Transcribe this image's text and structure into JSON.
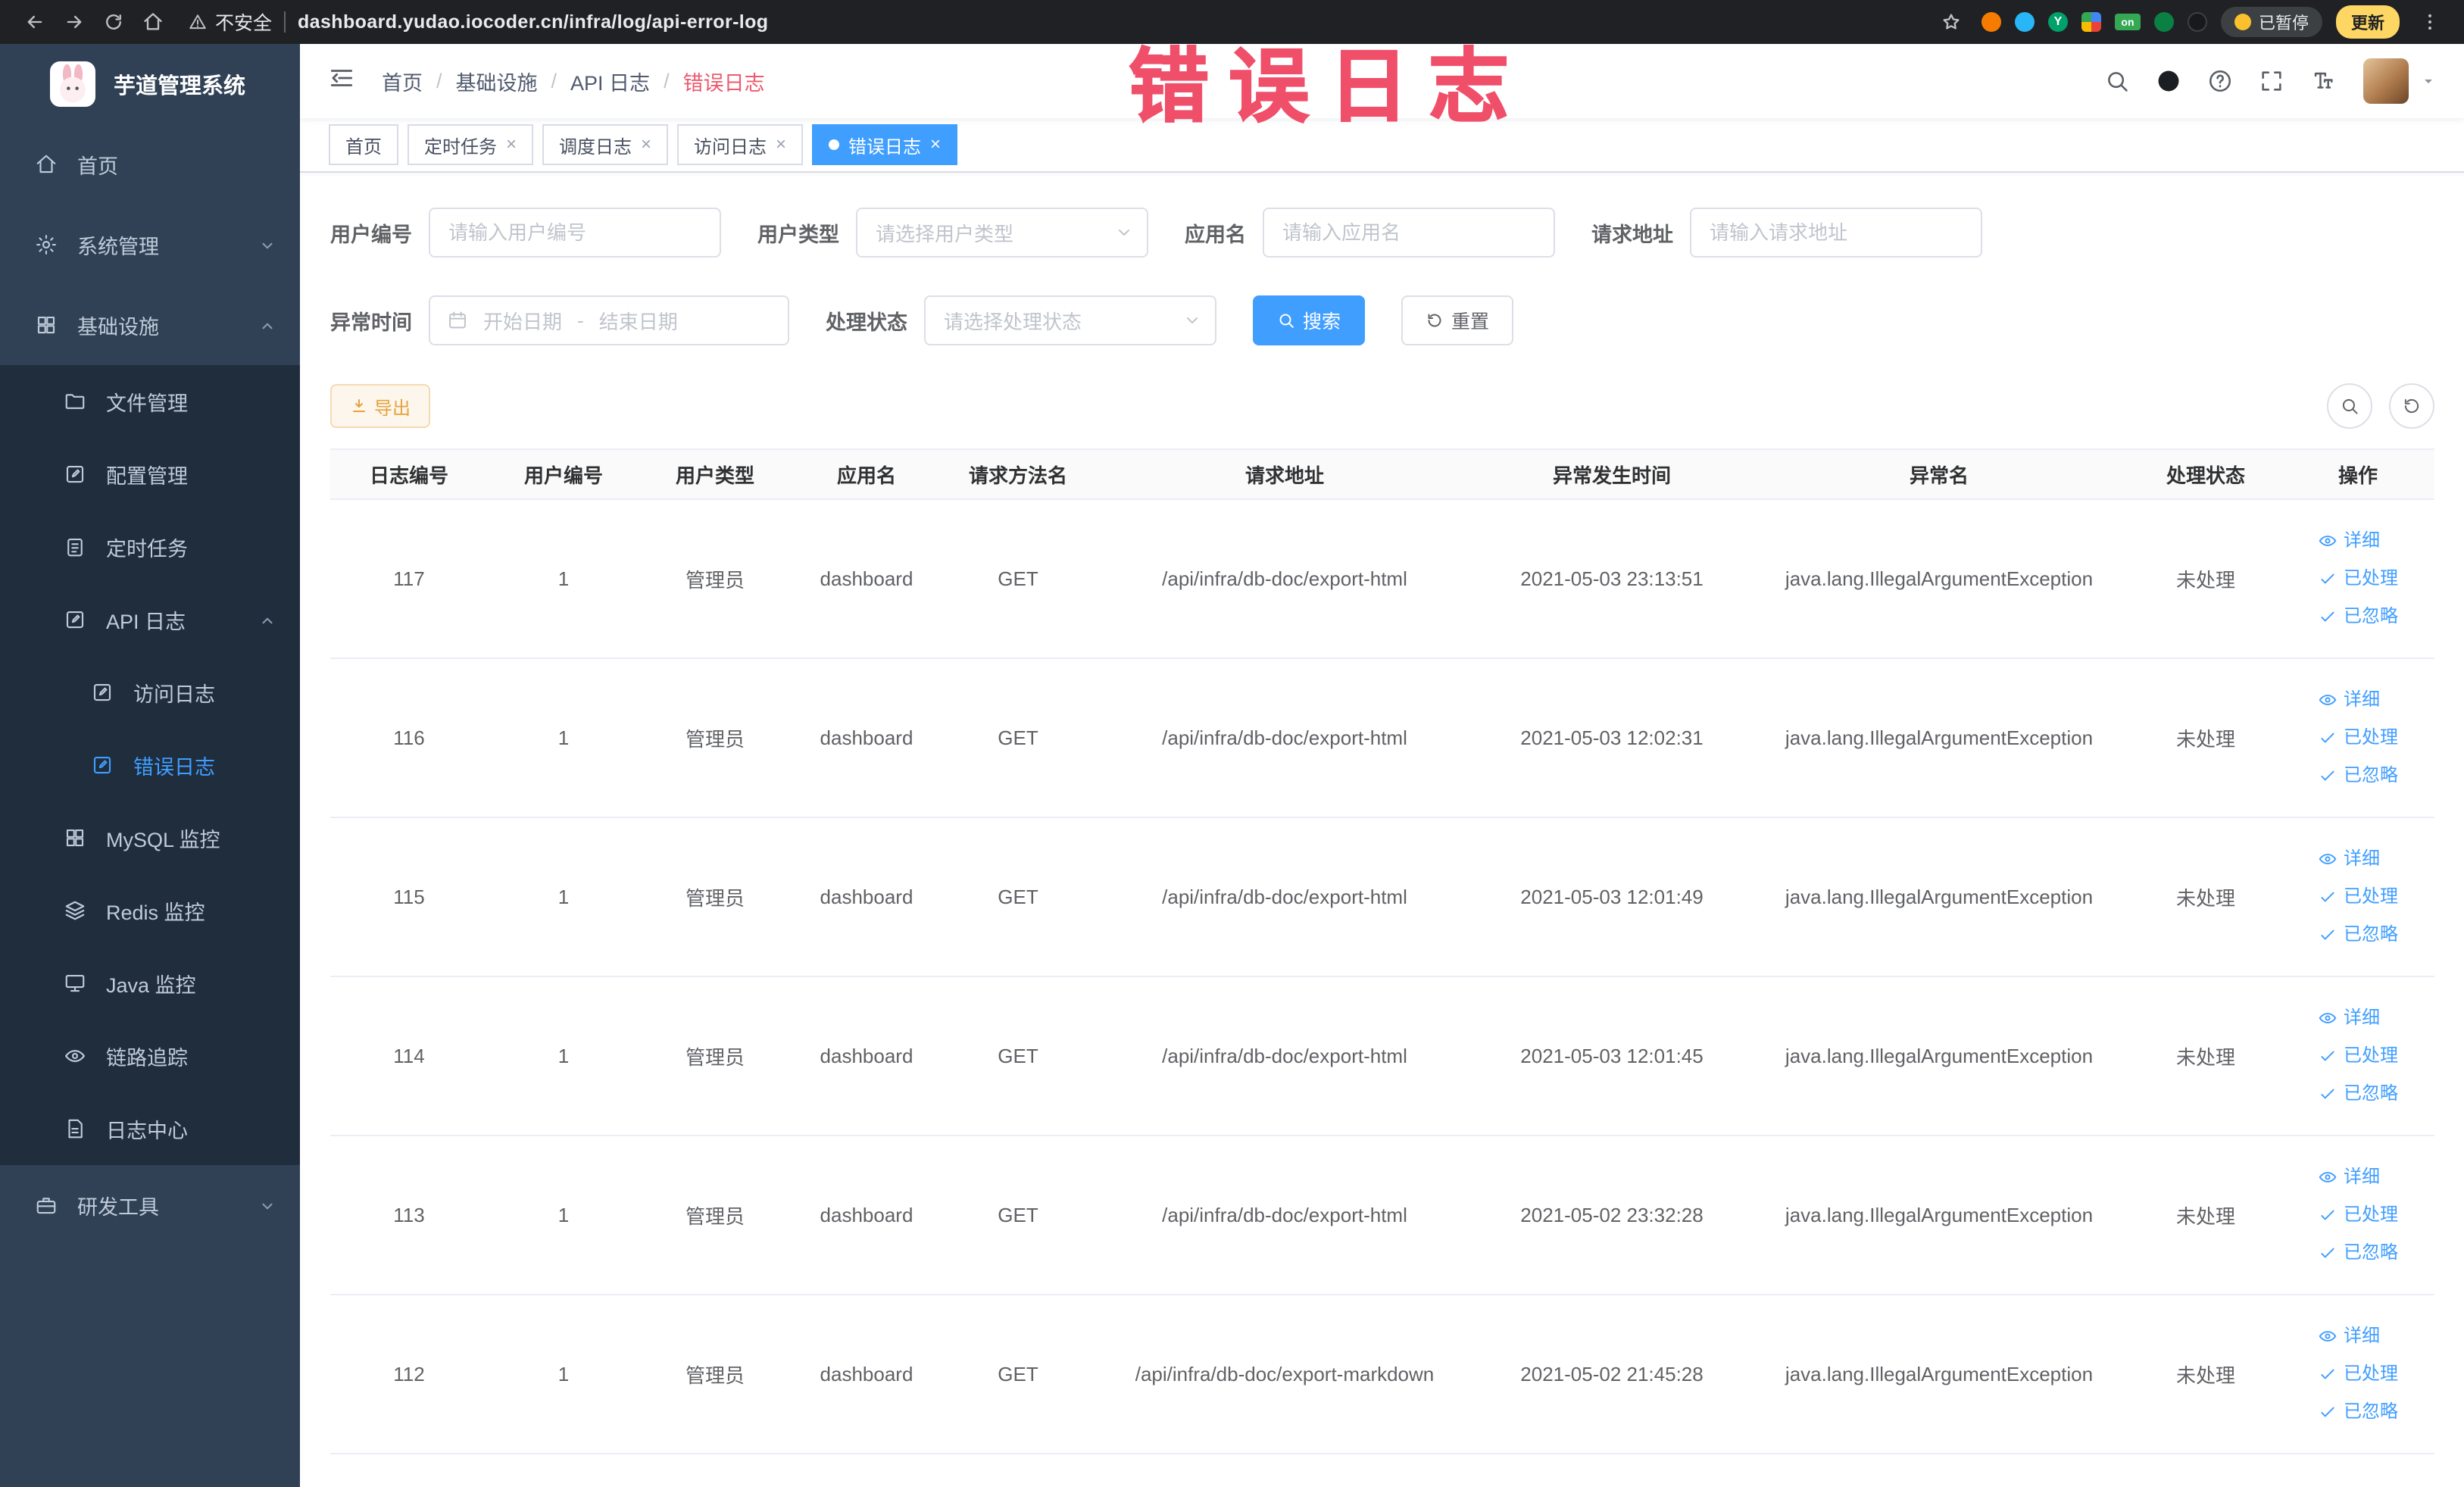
{
  "browser": {
    "security_label": "不安全",
    "url": "dashboard.yudao.iocoder.cn/infra/log/api-error-log",
    "paused_chip": "已暂停",
    "update_chip": "更新",
    "ext_y": "Y",
    "ext_on": "on"
  },
  "annotation": {
    "text": "错误日志"
  },
  "sidebar": {
    "logo_title": "芋道管理系统",
    "items": [
      {
        "key": "home",
        "label": "首页",
        "icon": "home",
        "level": 0
      },
      {
        "key": "system",
        "label": "系统管理",
        "icon": "gear",
        "level": 0,
        "arrow": "down"
      },
      {
        "key": "infra",
        "label": "基础设施",
        "icon": "grid",
        "level": 0,
        "arrow": "up"
      },
      {
        "key": "file",
        "label": "文件管理",
        "icon": "folder",
        "level": 1
      },
      {
        "key": "config",
        "label": "配置管理",
        "icon": "editsq",
        "level": 1
      },
      {
        "key": "job",
        "label": "定时任务",
        "icon": "clipboard",
        "level": 1
      },
      {
        "key": "api-log",
        "label": "API 日志",
        "icon": "editsq",
        "level": 1,
        "arrow": "up"
      },
      {
        "key": "access-log",
        "label": "访问日志",
        "icon": "editsq",
        "level": 2
      },
      {
        "key": "error-log",
        "label": "错误日志",
        "icon": "editsq",
        "level": 2,
        "active": true
      },
      {
        "key": "mysql",
        "label": "MySQL 监控",
        "icon": "grid",
        "level": 1
      },
      {
        "key": "redis",
        "label": "Redis 监控",
        "icon": "layers",
        "level": 1
      },
      {
        "key": "java",
        "label": "Java 监控",
        "icon": "monitor",
        "level": 1
      },
      {
        "key": "trace",
        "label": "链路追踪",
        "icon": "eye",
        "level": 1
      },
      {
        "key": "log-center",
        "label": "日志中心",
        "icon": "doc",
        "level": 1
      },
      {
        "key": "dev-tools",
        "label": "研发工具",
        "icon": "toolbox",
        "level": 0,
        "arrow": "down"
      }
    ]
  },
  "header": {
    "breadcrumb": [
      "首页",
      "基础设施",
      "API 日志",
      "错误日志"
    ],
    "action_icons": [
      "search",
      "github",
      "question",
      "fullscreen",
      "fontsize"
    ]
  },
  "tabs": [
    {
      "key": "home",
      "label": "首页",
      "closable": false,
      "active": false
    },
    {
      "key": "job",
      "label": "定时任务",
      "closable": true,
      "active": false
    },
    {
      "key": "job-log",
      "label": "调度日志",
      "closable": true,
      "active": false
    },
    {
      "key": "access-log",
      "label": "访问日志",
      "closable": true,
      "active": false
    },
    {
      "key": "error-log",
      "label": "错误日志",
      "closable": true,
      "active": true
    }
  ],
  "filters": {
    "user_id": {
      "label": "用户编号",
      "placeholder": "请输入用户编号"
    },
    "user_type": {
      "label": "用户类型",
      "placeholder": "请选择用户类型"
    },
    "app_name": {
      "label": "应用名",
      "placeholder": "请输入应用名"
    },
    "request_url": {
      "label": "请求地址",
      "placeholder": "请输入请求地址"
    },
    "exception_time": {
      "label": "异常时间",
      "start_placeholder": "开始日期",
      "separator": "-",
      "end_placeholder": "结束日期"
    },
    "process_status": {
      "label": "处理状态",
      "placeholder": "请选择处理状态"
    },
    "search_label": "搜索",
    "reset_label": "重置"
  },
  "toolbar": {
    "export_label": "导出"
  },
  "table": {
    "columns": [
      {
        "key": "id",
        "label": "日志编号"
      },
      {
        "key": "user_id",
        "label": "用户编号"
      },
      {
        "key": "user_type",
        "label": "用户类型"
      },
      {
        "key": "app",
        "label": "应用名"
      },
      {
        "key": "method",
        "label": "请求方法名"
      },
      {
        "key": "url",
        "label": "请求地址"
      },
      {
        "key": "time",
        "label": "异常发生时间"
      },
      {
        "key": "exception",
        "label": "异常名"
      },
      {
        "key": "status",
        "label": "处理状态"
      },
      {
        "key": "actions",
        "label": "操作"
      }
    ],
    "row_actions": [
      {
        "key": "detail",
        "label": "详细",
        "icon": "eye"
      },
      {
        "key": "processed",
        "label": "已处理",
        "icon": "check"
      },
      {
        "key": "ignored",
        "label": "已忽略",
        "icon": "check"
      }
    ],
    "rows": [
      {
        "id": "117",
        "user_id": "1",
        "user_type": "管理员",
        "app": "dashboard",
        "method": "GET",
        "url": "/api/infra/db-doc/export-html",
        "time": "2021-05-03 23:13:51",
        "exception": "java.lang.IllegalArgumentException",
        "status": "未处理"
      },
      {
        "id": "116",
        "user_id": "1",
        "user_type": "管理员",
        "app": "dashboard",
        "method": "GET",
        "url": "/api/infra/db-doc/export-html",
        "time": "2021-05-03 12:02:31",
        "exception": "java.lang.IllegalArgumentException",
        "status": "未处理"
      },
      {
        "id": "115",
        "user_id": "1",
        "user_type": "管理员",
        "app": "dashboard",
        "method": "GET",
        "url": "/api/infra/db-doc/export-html",
        "time": "2021-05-03 12:01:49",
        "exception": "java.lang.IllegalArgumentException",
        "status": "未处理"
      },
      {
        "id": "114",
        "user_id": "1",
        "user_type": "管理员",
        "app": "dashboard",
        "method": "GET",
        "url": "/api/infra/db-doc/export-html",
        "time": "2021-05-03 12:01:45",
        "exception": "java.lang.IllegalArgumentException",
        "status": "未处理"
      },
      {
        "id": "113",
        "user_id": "1",
        "user_type": "管理员",
        "app": "dashboard",
        "method": "GET",
        "url": "/api/infra/db-doc/export-html",
        "time": "2021-05-02 23:32:28",
        "exception": "java.lang.IllegalArgumentException",
        "status": "未处理"
      },
      {
        "id": "112",
        "user_id": "1",
        "user_type": "管理员",
        "app": "dashboard",
        "method": "GET",
        "url": "/api/infra/db-doc/export-markdown",
        "time": "2021-05-02 21:45:28",
        "exception": "java.lang.IllegalArgumentException",
        "status": "未处理"
      }
    ]
  },
  "colors": {
    "primary": "#409eff",
    "warning": "#e6a23c",
    "annotation": "#ef415e",
    "sidebar_bg": "#304156",
    "submenu_bg": "#1f2d3d"
  }
}
